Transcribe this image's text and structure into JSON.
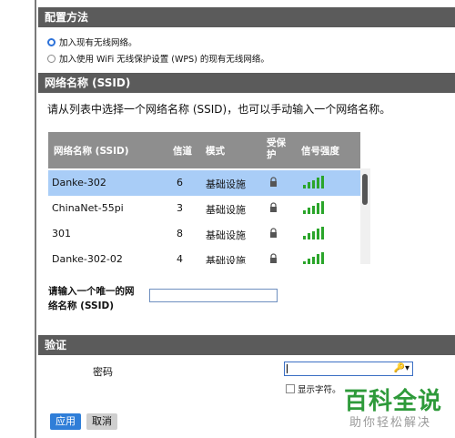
{
  "sections": {
    "config": "配置方法",
    "ssid": "网络名称 (SSID)",
    "auth": "验证"
  },
  "config_options": [
    {
      "label": "加入现有无线网络。",
      "selected": true
    },
    {
      "label": "加入使用 WiFi 无线保护设置 (WPS) 的现有无线网络。",
      "selected": false
    }
  ],
  "instruction": "请从列表中选择一个网络名称 (SSID)，也可以手动输入一个网络名称。",
  "table": {
    "headers": {
      "name": "网络名称 (SSID)",
      "channel": "信道",
      "mode": "模式",
      "security": "受保护",
      "signal": "信号强度"
    },
    "rows": [
      {
        "name": "Danke-302",
        "channel": "6",
        "mode": "基础设施",
        "locked": true,
        "signal_bars": 5,
        "selected": true
      },
      {
        "name": "ChinaNet-55pi",
        "channel": "3",
        "mode": "基础设施",
        "locked": true,
        "signal_bars": 5,
        "selected": false
      },
      {
        "name": "301",
        "channel": "8",
        "mode": "基础设施",
        "locked": true,
        "signal_bars": 5,
        "selected": false
      },
      {
        "name": "Danke-302-02",
        "channel": "4",
        "mode": "基础设施",
        "locked": true,
        "signal_bars": 5,
        "selected": false
      }
    ]
  },
  "ssid_input": {
    "label": "请输入一个唯一的网络名称 (SSID)",
    "label_line1": "请输入一个唯一的网",
    "label_line2": "络名称 (SSID)",
    "value": ""
  },
  "password": {
    "label": "密码",
    "value": "",
    "show_chars": "显示字符。"
  },
  "buttons": {
    "apply": "应用",
    "cancel": "取消"
  },
  "watermark": {
    "line1": "百科全说",
    "line2": "助你轻松解决"
  },
  "colors": {
    "header_bg": "#5b5b5b",
    "selection": "#a9cdf7",
    "accent": "#2f7ed8",
    "signal": "#2aa52a"
  }
}
